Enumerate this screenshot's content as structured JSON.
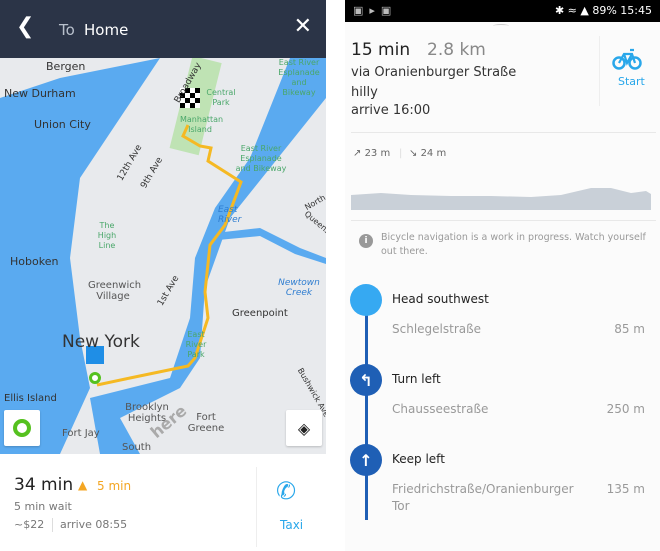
{
  "header": {
    "back_icon": "chevron-left-icon",
    "to_label": "To",
    "destination": "Home",
    "close_icon": "close-icon"
  },
  "map": {
    "labels": [
      "Bergen",
      "New Durham",
      "Union City",
      "12th Ave",
      "9th Ave",
      "Broadway",
      "Central Park",
      "Manhattan Island",
      "East River Esplanade and Bikeway",
      "East River Esplanade and Bikeway",
      "East River",
      "The High Line",
      "Hoboken",
      "Greenwich Village",
      "1st Ave",
      "Newtown Creek",
      "Greenpoint",
      "New York",
      "East River Park",
      "Ellis Island",
      "Brooklyn Heights",
      "Fort Greene",
      "Fort Jay",
      "South",
      "Bushwick Ave",
      "North",
      "Queens",
      "here"
    ],
    "route_color": "#f5b923",
    "water_color": "#5aaaf0",
    "location_button_icon": "location-tracking-icon",
    "layers_button_icon": "layers-icon",
    "destination_icon": "checkered-flag-icon"
  },
  "trip": {
    "duration": "34 min",
    "delay": "5 min",
    "warning_icon": "warning-icon",
    "wait": "5 min wait",
    "cost": "~$22",
    "arrive": "arrive 08:55",
    "taxi_label": "Taxi",
    "phone_icon": "phone-icon"
  },
  "status_bar": {
    "battery": "89%",
    "time": "15:45"
  },
  "route": {
    "duration": "15 min",
    "distance": "2.8 km",
    "via": "via Oranienburger Straße",
    "terrain": "hilly",
    "arrive": "arrive 16:00",
    "start_label": "Start",
    "bike_icon": "bicycle-icon",
    "ascent": "23 m",
    "descent": "24 m"
  },
  "notice": "Bicycle navigation is a work in progress. Watch yourself out there.",
  "steps": [
    {
      "title": "Head southwest",
      "street": "Schlegelstraße",
      "distance": "85 m",
      "icon": "start-dot-icon"
    },
    {
      "title": "Turn left",
      "street": "Chausseestraße",
      "distance": "250 m",
      "icon": "turn-left-icon"
    },
    {
      "title": "Keep left",
      "street": "Friedrichstraße/Oranienburger Tor",
      "distance": "135 m",
      "icon": "keep-left-icon"
    }
  ]
}
